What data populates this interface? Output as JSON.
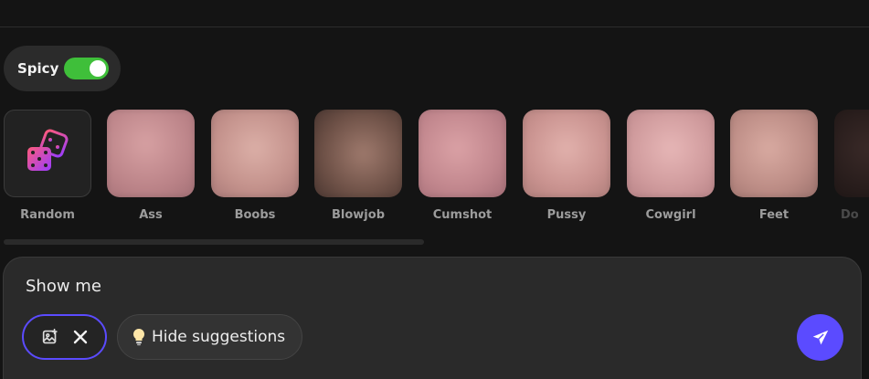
{
  "spicy": {
    "label": "Spicy",
    "enabled": true
  },
  "categories": [
    {
      "label": "Random",
      "icon": "dice-icon"
    },
    {
      "label": "Ass"
    },
    {
      "label": "Boobs"
    },
    {
      "label": "Blowjob"
    },
    {
      "label": "Cumshot"
    },
    {
      "label": "Pussy"
    },
    {
      "label": "Cowgirl"
    },
    {
      "label": "Feet"
    },
    {
      "label": "Do"
    }
  ],
  "composer": {
    "text": "Show me",
    "hide_suggestions_label": "Hide suggestions",
    "icons": {
      "image": "image-icon",
      "close": "close-icon",
      "bulb": "lightbulb-icon",
      "send": "send-icon"
    }
  },
  "colors": {
    "accent": "#5b4bff",
    "toggle_on": "#3fbf3a"
  }
}
